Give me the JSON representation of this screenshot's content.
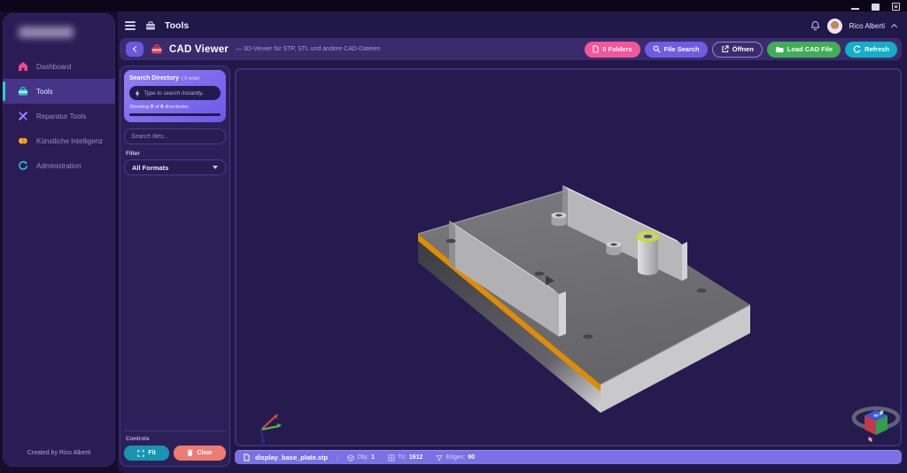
{
  "window": {
    "title_hidden": "",
    "controls": [
      "minimize",
      "maximize",
      "close"
    ]
  },
  "sidebar": {
    "items": [
      {
        "label": "Dashboard",
        "icon": "home-icon"
      },
      {
        "label": "Tools",
        "icon": "toolbox-icon",
        "active": true
      },
      {
        "label": "Reparatur Tools",
        "icon": "repair-tools-icon"
      },
      {
        "label": "Künstliche Intelligenz",
        "icon": "brain-icon"
      },
      {
        "label": "Administration",
        "icon": "sync-icon"
      }
    ],
    "footer": "Created by Rico Alberti"
  },
  "topbar": {
    "title": "Tools",
    "user": "Rico Alberti"
  },
  "header": {
    "title": "CAD Viewer",
    "subtitle": "— 3D-Viewer für STP, STL und andere CAD-Dateien",
    "folders_button": "0 Folders",
    "file_search_button": "File Search",
    "open_button": "Öffnen",
    "load_button": "Load CAD File",
    "refresh_button": "Refresh"
  },
  "panel": {
    "search_directory_title": "Search Directory",
    "search_directory_count": "( 0  total)",
    "instant_placeholder": "Type to search instantly..",
    "showing_prefix": "Showing",
    "showing_n1": "0",
    "showing_of": "of",
    "showing_n2": "0",
    "showing_suffix": "directories",
    "files_placeholder": "Search files...",
    "filter_label": "Filter",
    "format_value": "All Formats",
    "controls_label": "Controls",
    "fit_button": "Fit",
    "clear_button": "Clear"
  },
  "statusbar": {
    "filename": "display_base_plate.stp",
    "obj_label": "Obj:",
    "obj_value": "1",
    "tri_label": "Tri:",
    "tri_value": "1612",
    "edges_label": "Edges:",
    "edges_value": "90"
  },
  "colors": {
    "accent_purple": "#6c59e8",
    "accent_pink": "#f4569a",
    "accent_green": "#3fae57",
    "accent_teal": "#14aec7",
    "danger_salmon": "#ee7b71",
    "highlight_edge_orange": "#e08c00",
    "highlight_ring_yellow": "#ccdf12",
    "viewport_bg": "#251b4e",
    "statusbar_bg": "#7b70e4"
  }
}
